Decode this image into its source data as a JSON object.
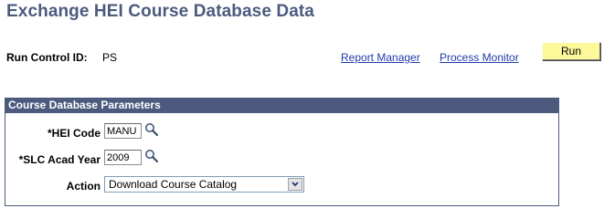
{
  "page": {
    "title": "Exchange HEI Course Database Data"
  },
  "run_control": {
    "label": "Run Control ID:",
    "value": "PS"
  },
  "links": {
    "report_manager": "Report Manager",
    "process_monitor": "Process Monitor"
  },
  "toolbar": {
    "run_label": "Run"
  },
  "parameters": {
    "header": "Course Database Parameters",
    "hei_code": {
      "label": "*HEI Code",
      "value": "MANU"
    },
    "slc_acad_year": {
      "label": "*SLC Acad Year",
      "value": "2009"
    },
    "action": {
      "label": "Action",
      "selected": "Download Course Catalog"
    }
  },
  "colors": {
    "title": "#4c5a7e",
    "group_header_bg": "#4c5a7e",
    "link": "#1f3bae",
    "run_button_bg": "#fdf99a"
  },
  "icons": {
    "lookup": "magnifier-icon",
    "dropdown": "chevron-down-icon"
  }
}
